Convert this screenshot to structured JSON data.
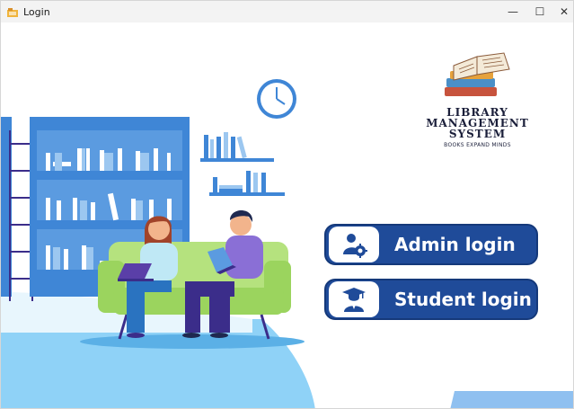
{
  "window": {
    "title": "Login",
    "minimize_glyph": "—",
    "maximize_glyph": "☐",
    "close_glyph": "✕"
  },
  "logo": {
    "line1": "LIBRARY",
    "line2": "MANAGEMENT",
    "line3": "SYSTEM",
    "tagline": "BOOKS EXPAND MINDS"
  },
  "buttons": {
    "admin_label": "Admin login",
    "student_label": "Student login",
    "admin_icon": "admin-settings-icon",
    "student_icon": "graduate-icon"
  },
  "colors": {
    "button_bg": "#1f4b99",
    "shelf_blue": "#3f86d6",
    "sofa_green": "#9bd45e",
    "floor_blue": "#8fd2f7",
    "accent_purple": "#3b2d8a"
  }
}
